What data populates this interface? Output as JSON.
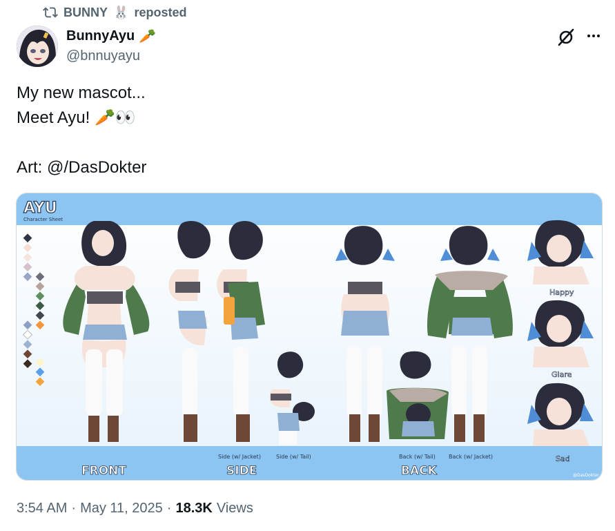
{
  "repost": {
    "user": "BUNNY",
    "label": "reposted"
  },
  "author": {
    "name": "BunnyAyu",
    "handle": "@bnnuyayu"
  },
  "tweet": {
    "lines": [
      "My new mascot...",
      "Meet Ayu! 🥕👀",
      "",
      "Art: @/DasDokter"
    ]
  },
  "sheet": {
    "title": "AYU",
    "subtitle": "Character Sheet",
    "labels": {
      "front": "FRONT",
      "side": "SIDE",
      "back": "BACK",
      "side_jacket": "Side (w/ Jacket)",
      "side_tail": "Side (w/ Tail)",
      "back_tail": "Back (w/ Tail)",
      "back_jacket": "Back (w/ Jacket)",
      "happy": "Happy",
      "glare": "Glare",
      "sad": "Sad",
      "credit": "@DasDokter"
    }
  },
  "meta": {
    "time": "3:54 AM",
    "date": "May 11, 2025",
    "views_count": "18.3K",
    "views_label": "Views"
  },
  "colors": {
    "accent": "#7fb8ec",
    "text_secondary": "#536471"
  },
  "icons": [
    "repost-icon",
    "bunny-emoji-icon",
    "carrot-emoji-icon",
    "grok-icon",
    "more-icon"
  ]
}
